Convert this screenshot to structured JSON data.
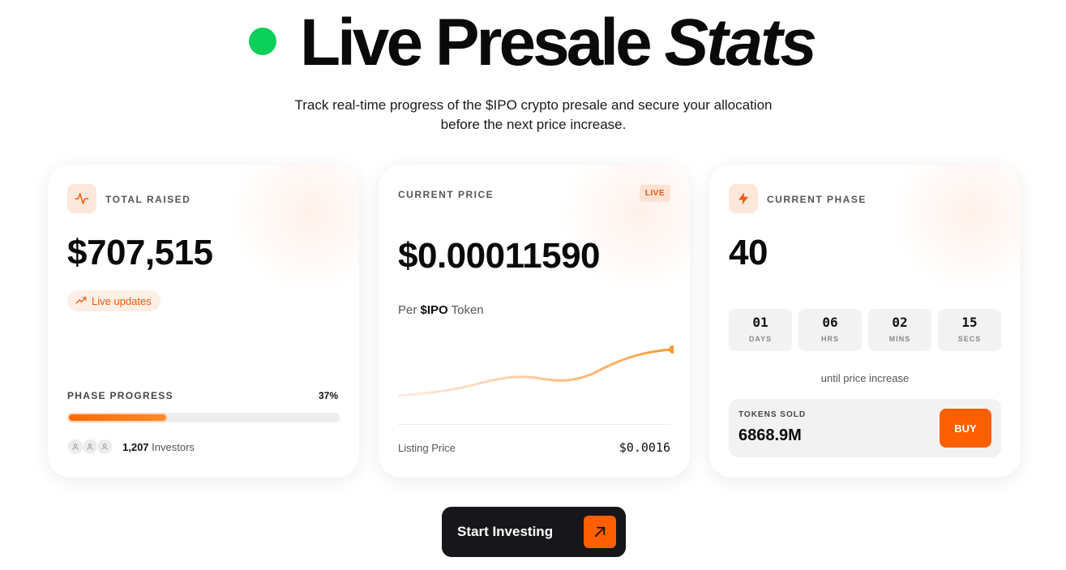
{
  "hero": {
    "title_main": "Live Presale",
    "title_italic": "Stats",
    "subtitle": "Track real-time progress of the $IPO crypto presale and secure your allocation before the next price increase."
  },
  "total_raised": {
    "icon": "activity-icon",
    "label": "TOTAL RAISED",
    "value": "$707,515",
    "pill_icon": "trending-up-icon",
    "pill_label": "Live updates",
    "phase_label": "PHASE PROGRESS",
    "phase_percent_text": "37%",
    "phase_progress": 0.37,
    "investor_count": "1,207",
    "investor_label": "Investors"
  },
  "current_price": {
    "label": "CURRENT PRICE",
    "badge": "LIVE",
    "value": "$0.00011590",
    "per_prefix": "Per",
    "per_token": "$IPO",
    "per_suffix": "Token",
    "listing_label": "Listing Price",
    "listing_value": "$0.0016"
  },
  "current_phase": {
    "icon": "lightning-icon",
    "label": "CURRENT PHASE",
    "value": "40",
    "countdown": [
      {
        "value": "01",
        "unit": "DAYS"
      },
      {
        "value": "06",
        "unit": "HRS"
      },
      {
        "value": "02",
        "unit": "MINS"
      },
      {
        "value": "15",
        "unit": "SECS"
      }
    ],
    "until_text": "until price increase",
    "tokens_label": "TOKENS SOLD",
    "tokens_value": "6868.9M",
    "buy_label": "BUY"
  },
  "cta": {
    "label": "Start Investing",
    "icon": "arrow-up-right-icon"
  },
  "colors": {
    "accent": "#ff5f00",
    "live_green": "#0ad05a",
    "dark": "#17161a"
  }
}
